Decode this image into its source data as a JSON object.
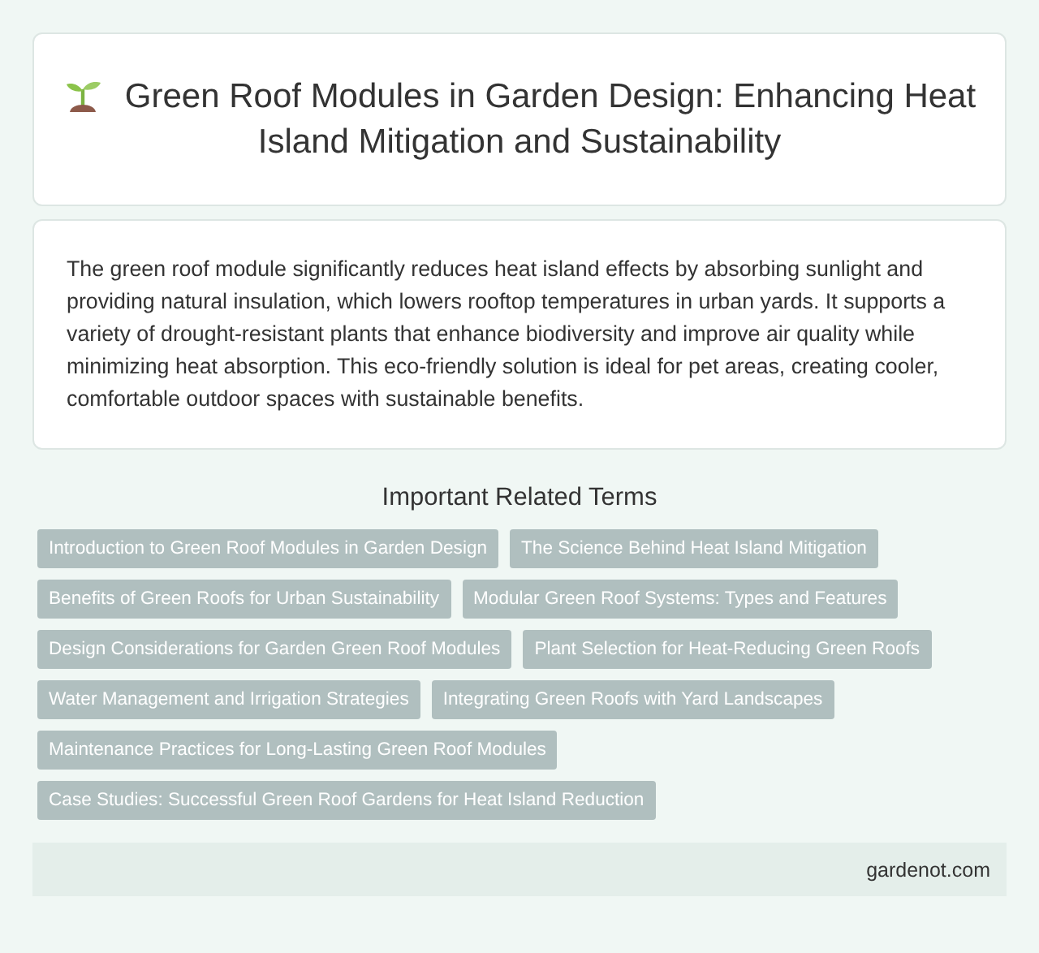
{
  "header": {
    "title": "Green Roof Modules in Garden Design: Enhancing Heat Island Mitigation and Sustainability"
  },
  "description": "The green roof module significantly reduces heat island effects by absorbing sunlight and providing natural insulation, which lowers rooftop temperatures in urban yards. It supports a variety of drought-resistant plants that enhance biodiversity and improve air quality while minimizing heat absorption. This eco-friendly solution is ideal for pet areas, creating cooler, comfortable outdoor spaces with sustainable benefits.",
  "related": {
    "heading": "Important Related Terms",
    "terms": [
      "Introduction to Green Roof Modules in Garden Design",
      "The Science Behind Heat Island Mitigation",
      "Benefits of Green Roofs for Urban Sustainability",
      "Modular Green Roof Systems: Types and Features",
      "Design Considerations for Garden Green Roof Modules",
      "Plant Selection for Heat-Reducing Green Roofs",
      "Water Management and Irrigation Strategies",
      "Integrating Green Roofs with Yard Landscapes",
      "Maintenance Practices for Long-Lasting Green Roof Modules",
      "Case Studies: Successful Green Roof Gardens for Heat Island Reduction"
    ]
  },
  "footer": {
    "site": "gardenot.com"
  }
}
